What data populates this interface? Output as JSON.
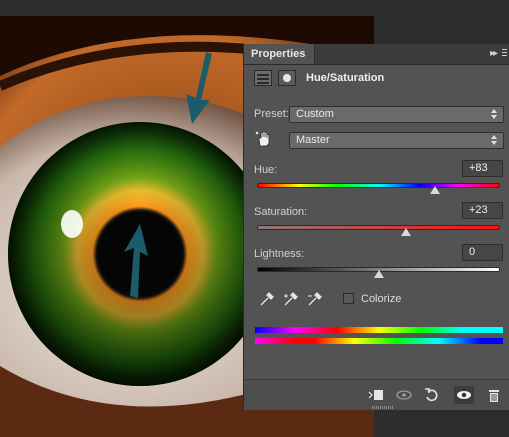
{
  "panel": {
    "tab_label": "Properties",
    "menu_icon": "panel-collapse-icon",
    "title": "Hue/Saturation",
    "preset_label": "Preset:",
    "preset_value": "Custom",
    "channel_value": "Master",
    "hue_label": "Hue:",
    "hue_value": "+83",
    "hue_level": 83,
    "saturation_label": "Saturation:",
    "saturation_value": "+23",
    "saturation_level": 23,
    "lightness_label": "Lightness:",
    "lightness_value": "0",
    "lightness_level": 0,
    "colorize_label": "Colorize",
    "colorize_checked": false
  },
  "footer": {
    "icons": [
      "clip-to-layer-icon",
      "view-previous-icon",
      "reset-icon",
      "visibility-eye-icon",
      "trash-icon"
    ]
  },
  "colors": {
    "panel_bg": "#535353",
    "arrow_annotation": "#1b5c6a"
  }
}
